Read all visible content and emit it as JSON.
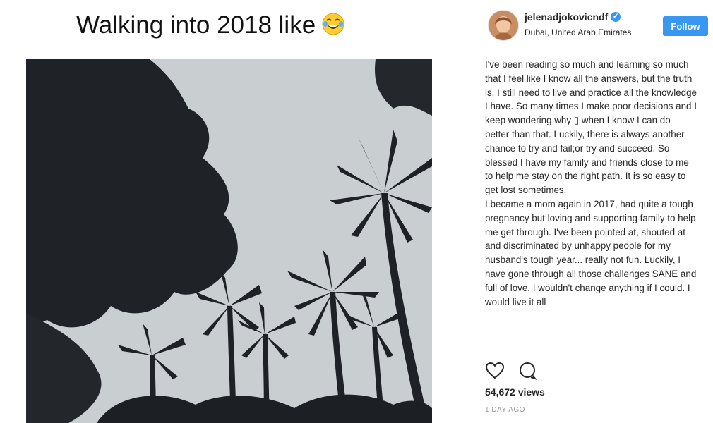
{
  "post": {
    "title_text": "Walking into 2018 like",
    "title_emoji": "laughing-tears-emoji"
  },
  "header": {
    "username": "jelenadjokovicndf",
    "location": "Dubai, United Arab Emirates",
    "follow_label": "Follow",
    "verified": true
  },
  "caption": {
    "paragraph_1": "I've been reading so much and learning so much that I feel like I know all the answers, but the truth is, I still need to live and practice all the knowledge I have. So many times I make poor decisions and I keep wondering why ▯ when I know I can do better than that. Luckily, there is always another chance to try and fail;or try and succeed. So blessed I have my family and friends close to me to help me stay on the right path. It is so easy to get lost sometimes.",
    "paragraph_2": "I became a mom again in 2017, had quite a tough pregnancy but loving and supporting family to help me get through. I've been pointed at, shouted at and discriminated by unhappy people for my husband's tough year... really not fun. Luckily, I have gone through all those challenges SANE and full of love. I wouldn't change anything if I could. I would live it all"
  },
  "stats": {
    "views": "54,672 views",
    "time": "1 DAY AGO"
  },
  "colors": {
    "accent": "#3897f0",
    "sky": "#c8cdd0",
    "tree": "#1e2126"
  }
}
